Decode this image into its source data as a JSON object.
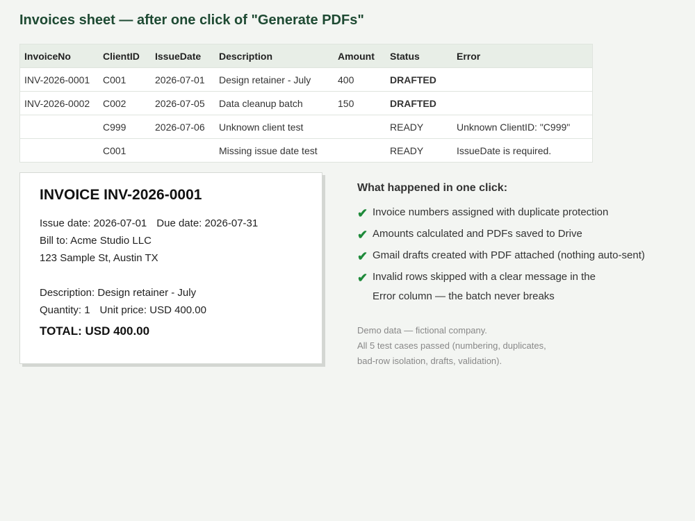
{
  "title": "Invoices sheet — after one click of \"Generate PDFs\"",
  "sheet": {
    "headers": [
      "InvoiceNo",
      "ClientID",
      "IssueDate",
      "Description",
      "Amount",
      "Status",
      "Error"
    ],
    "rows": [
      {
        "invoice_no": "INV-2026-0001",
        "client_id": "C001",
        "issue_date": "2026-07-01",
        "description": "Design retainer - July",
        "amount": "400",
        "status": "DRAFTED",
        "error": ""
      },
      {
        "invoice_no": "INV-2026-0002",
        "client_id": "C002",
        "issue_date": "2026-07-05",
        "description": "Data cleanup batch",
        "amount": "150",
        "status": "DRAFTED",
        "error": ""
      },
      {
        "invoice_no": "",
        "client_id": "C999",
        "issue_date": "2026-07-06",
        "description": "Unknown client test",
        "amount": "",
        "status": "READY",
        "error": "Unknown ClientID: \"C999\""
      },
      {
        "invoice_no": "",
        "client_id": "C001",
        "issue_date": "",
        "description": "Missing issue date test",
        "amount": "",
        "status": "READY",
        "error": "IssueDate is required."
      }
    ]
  },
  "invoice": {
    "title": "INVOICE INV-2026-0001",
    "issue_date": "Issue date: 2026-07-01",
    "due_date": "Due date: 2026-07-31",
    "bill_to": "Bill to: Acme Studio LLC",
    "address": "123 Sample St, Austin TX",
    "description": "Description: Design retainer - July",
    "quantity": "Quantity: 1",
    "unit_price": "Unit price: USD 400.00",
    "total": "TOTAL: USD 400.00"
  },
  "summary": {
    "title": "What happened in one click:",
    "items": [
      "Invoice numbers assigned with duplicate protection",
      "Amounts calculated and PDFs saved to Drive",
      "Gmail drafts created with PDF attached (nothing auto-sent)",
      "Invalid rows skipped with a clear message in the Error column — the batch never breaks"
    ],
    "note_lines": [
      "Demo data — fictional company.",
      "All 5 test cases passed (numbering, duplicates,",
      "bad-row isolation, drafts, validation)."
    ]
  },
  "colors": {
    "accent_green": "#1e8a3a",
    "title_green": "#1e4a33",
    "error_red": "#c0183a"
  },
  "icons": {
    "bullet": "check-icon"
  }
}
